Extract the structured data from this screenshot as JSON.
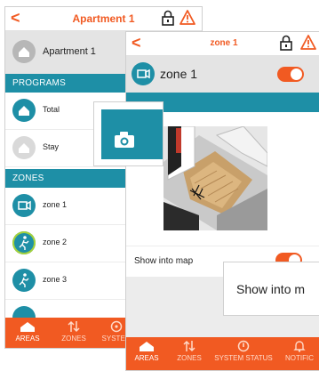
{
  "screen1": {
    "header": {
      "back": "<",
      "title": "Apartment 1"
    },
    "area": {
      "name": "Apartment 1"
    },
    "programs": {
      "title": "PROGRAMS",
      "items": [
        {
          "label": "Total",
          "icon": "home-icon"
        },
        {
          "label": "Stay",
          "icon": "home-icon"
        }
      ]
    },
    "zones": {
      "title": "ZONES",
      "items": [
        {
          "label": "zone 1",
          "icon": "camera-icon"
        },
        {
          "label": "zone 2",
          "icon": "motion-icon"
        },
        {
          "label": "zone 3",
          "icon": "motion-icon"
        }
      ]
    },
    "tabs": [
      {
        "label": "AREAS",
        "icon": "home-icon",
        "active": true
      },
      {
        "label": "ZONES",
        "icon": "sort-icon",
        "active": false
      },
      {
        "label": "SYSTEM",
        "icon": "gear-icon",
        "active": false
      }
    ]
  },
  "screen2": {
    "header": {
      "back": "<",
      "title": "zone 1"
    },
    "zone": {
      "name": "zone 1",
      "enabled": true
    },
    "map_row": {
      "label": "Show into map",
      "enabled": true
    },
    "tooltip": {
      "text": "Show into m"
    },
    "tabs": [
      {
        "label": "AREAS",
        "icon": "home-icon",
        "active": true
      },
      {
        "label": "ZONES",
        "icon": "sort-icon",
        "active": false
      },
      {
        "label": "SYSTEM STATUS",
        "icon": "status-icon",
        "active": false
      },
      {
        "label": "NOTIFIC",
        "icon": "bell-icon",
        "active": false
      }
    ]
  },
  "colors": {
    "accent": "#f15a22",
    "teal": "#1e8fa6"
  }
}
